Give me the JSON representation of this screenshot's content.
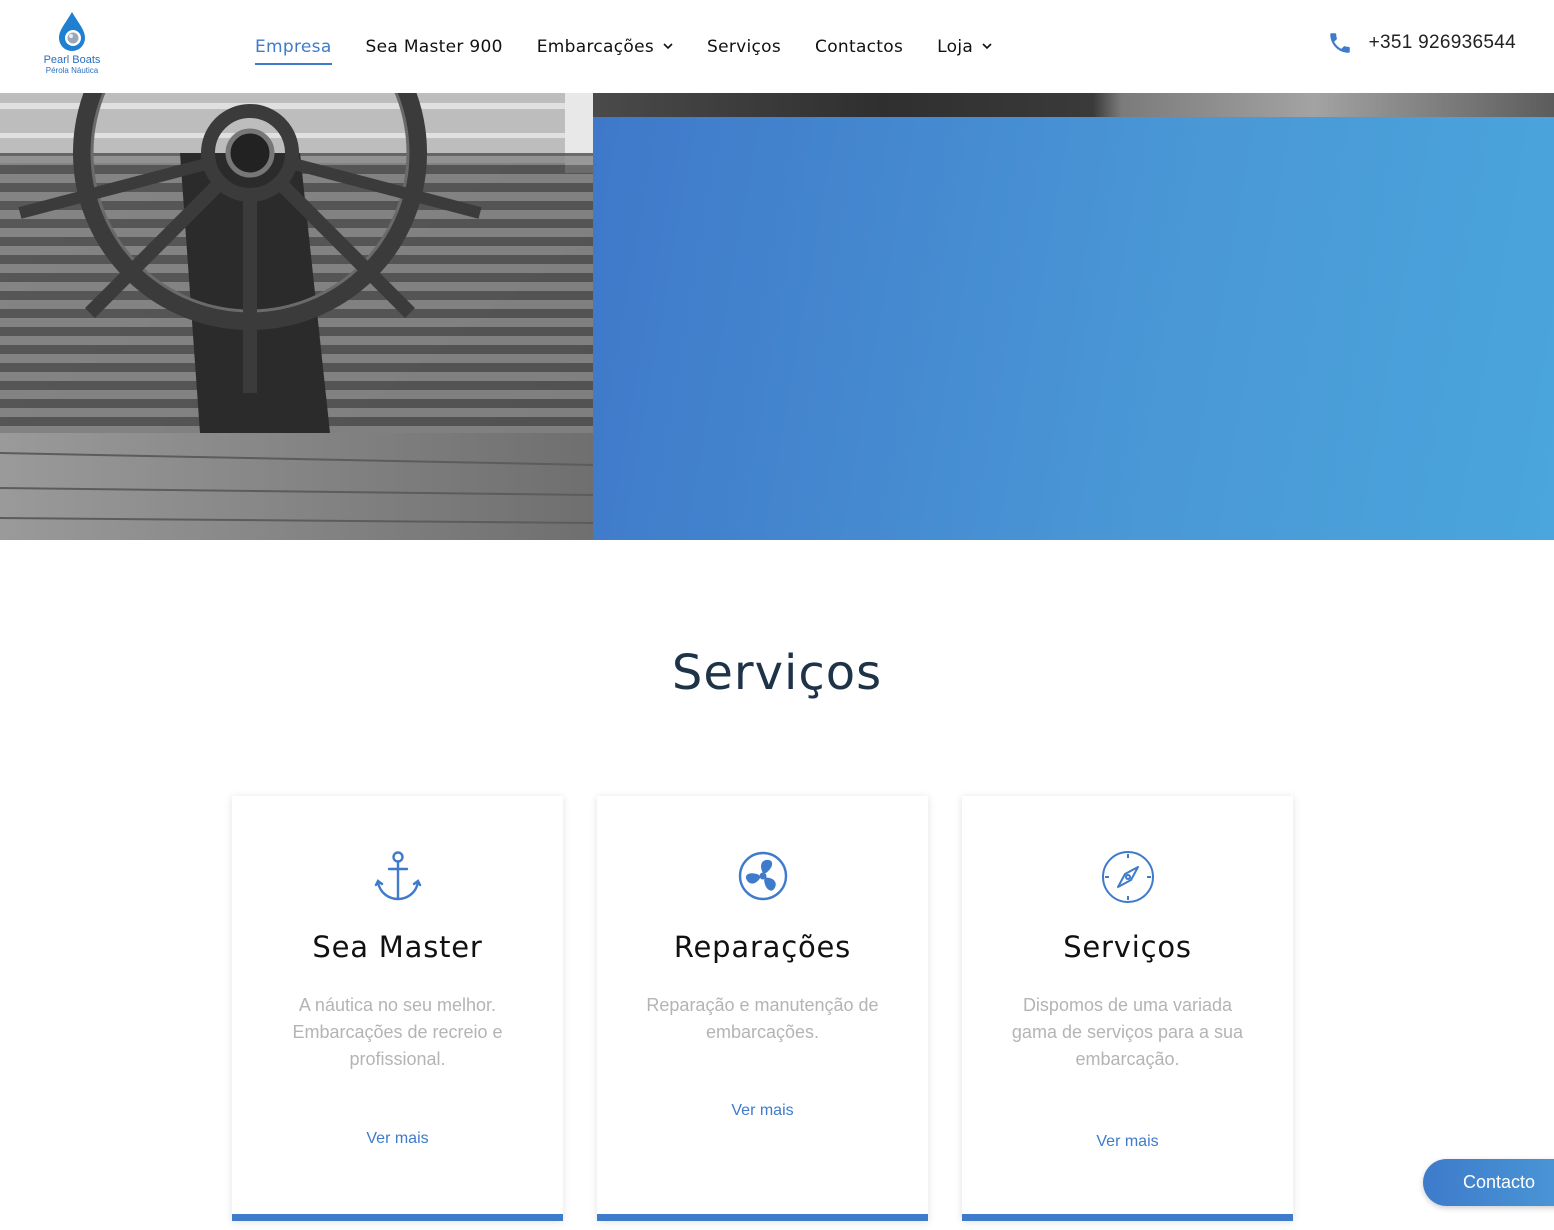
{
  "brand": {
    "name": "Pearl Boats",
    "tagline": "Pérola Náutica",
    "logo_icon": "water-drop-pearl-icon",
    "accent_color": "#3e7bcb"
  },
  "nav": {
    "items": [
      {
        "label": "Empresa",
        "active": true
      },
      {
        "label": "Sea Master 900",
        "active": false
      },
      {
        "label": "Embarcações",
        "active": false,
        "dropdown": true
      },
      {
        "label": "Serviços",
        "active": false
      },
      {
        "label": "Contactos",
        "active": false
      },
      {
        "label": "Loja",
        "active": false,
        "dropdown": true
      }
    ]
  },
  "phone": {
    "icon": "phone-icon",
    "number": "+351 926936544"
  },
  "hero": {
    "image": "ship-steering-wheel-bw-photo",
    "panel_gradient": [
      "#3f78c9",
      "#4aa6dc"
    ]
  },
  "services": {
    "title": "Serviços",
    "cards": [
      {
        "icon": "anchor-icon",
        "title": "Sea Master",
        "description": "A náutica no seu melhor. Embarcações de recreio e profissional.",
        "link": "Ver mais"
      },
      {
        "icon": "propeller-fan-icon",
        "title": "Reparações",
        "description": "Reparação e manutenção de embarcações.",
        "link": "Ver mais"
      },
      {
        "icon": "compass-icon",
        "title": "Serviços",
        "description": "Dispomos de uma variada gama de serviços para a sua embarcação.",
        "link": "Ver mais"
      }
    ]
  },
  "floating_contact": {
    "label": "Contacto"
  }
}
